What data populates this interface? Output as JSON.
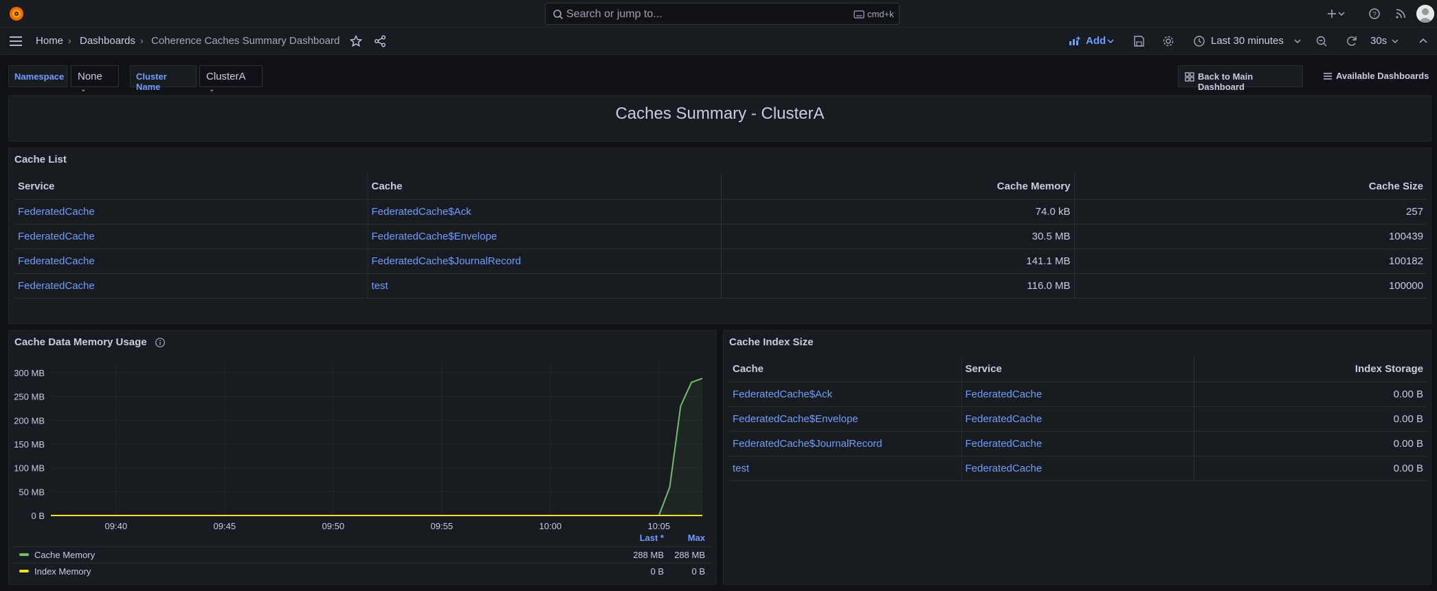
{
  "topbar": {
    "search_placeholder": "Search or jump to...",
    "search_shortcut": "cmd+k"
  },
  "navbar": {
    "breadcrumb": [
      "Home",
      "Dashboards",
      "Coherence Caches Summary Dashboard"
    ],
    "add_label": "Add",
    "time_range": "Last 30 minutes",
    "refresh_interval": "30s"
  },
  "variables": {
    "namespace_label": "Namespace",
    "namespace_value": "None",
    "cluster_label": "Cluster Name",
    "cluster_value": "ClusterA"
  },
  "links": {
    "back": "Back to Main Dashboard",
    "available": "Available Dashboards"
  },
  "summary_title": "Caches Summary - ClusterA",
  "cache_list": {
    "title": "Cache List",
    "headers": [
      "Service",
      "Cache",
      "Cache Memory",
      "Cache Size"
    ],
    "rows": [
      [
        "FederatedCache",
        "FederatedCache$Ack",
        "74.0 kB",
        "257"
      ],
      [
        "FederatedCache",
        "FederatedCache$Envelope",
        "30.5 MB",
        "100439"
      ],
      [
        "FederatedCache",
        "FederatedCache$JournalRecord",
        "141.1 MB",
        "100182"
      ],
      [
        "FederatedCache",
        "test",
        "116.0 MB",
        "100000"
      ]
    ]
  },
  "memory_panel": {
    "title": "Cache Data Memory Usage",
    "legend_headers": [
      "Last *",
      "Max"
    ]
  },
  "index_panel": {
    "title": "Cache Index Size",
    "headers": [
      "Cache",
      "Service",
      "Index Storage"
    ],
    "rows": [
      [
        "FederatedCache$Ack",
        "FederatedCache",
        "0.00 B"
      ],
      [
        "FederatedCache$Envelope",
        "FederatedCache",
        "0.00 B"
      ],
      [
        "FederatedCache$JournalRecord",
        "FederatedCache",
        "0.00 B"
      ],
      [
        "test",
        "FederatedCache",
        "0.00 B"
      ]
    ]
  },
  "colors": {
    "background": "#111217",
    "panel": "#181b1f",
    "link": "#6e9fff",
    "cache_memory_series": "#73bf69",
    "index_memory_series": "#fade2a"
  },
  "chart_data": {
    "type": "area",
    "title": "",
    "xlabel": "",
    "ylabel": "",
    "x_ticks": [
      "09:40",
      "09:45",
      "09:50",
      "09:55",
      "10:00",
      "10:05"
    ],
    "y_ticks": [
      "0 B",
      "50 MB",
      "100 MB",
      "150 MB",
      "200 MB",
      "250 MB",
      "300 MB"
    ],
    "ylim": [
      0,
      300
    ],
    "y_unit": "MB",
    "x": [
      "09:37",
      "09:40",
      "09:45",
      "09:50",
      "09:55",
      "10:00",
      "10:05",
      "10:05:30",
      "10:06",
      "10:06:30",
      "10:07"
    ],
    "series": [
      {
        "name": "Cache Memory",
        "color": "#73bf69",
        "values": [
          0,
          0,
          0,
          0,
          0,
          0,
          0,
          60,
          230,
          280,
          288
        ],
        "last": "288 MB",
        "max": "288 MB"
      },
      {
        "name": "Index Memory",
        "color": "#fade2a",
        "values": [
          0,
          0,
          0,
          0,
          0,
          0,
          0,
          0,
          0,
          0,
          0
        ],
        "last": "0 B",
        "max": "0 B"
      }
    ],
    "grid": true,
    "legend_position": "bottom"
  }
}
